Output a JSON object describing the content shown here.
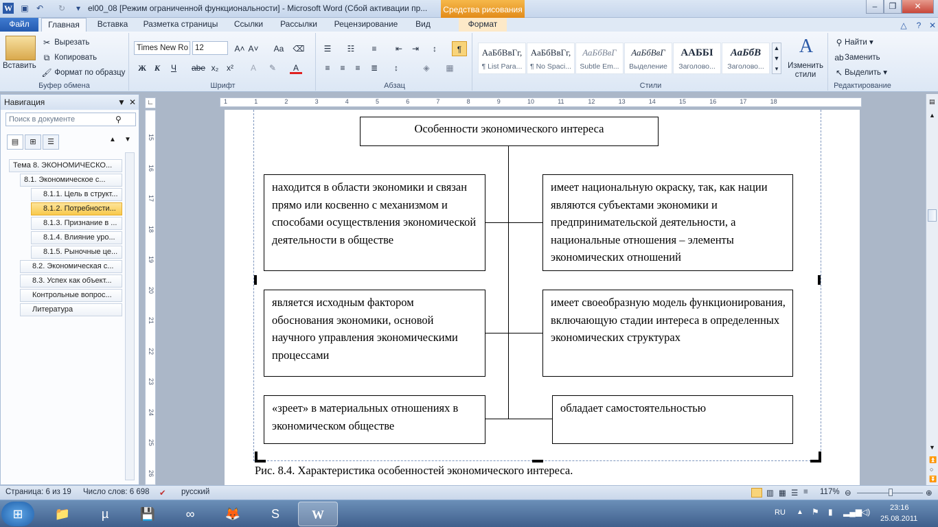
{
  "window": {
    "title": "el00_08 [Режим ограниченной функциональности]  -  Microsoft Word (Сбой активации пр...",
    "context_tab": "Средства рисования",
    "app_icon": "W"
  },
  "tabs": [
    {
      "label": "Файл"
    },
    {
      "label": "Главная"
    },
    {
      "label": "Вставка"
    },
    {
      "label": "Разметка страницы"
    },
    {
      "label": "Ссылки"
    },
    {
      "label": "Рассылки"
    },
    {
      "label": "Рецензирование"
    },
    {
      "label": "Вид"
    },
    {
      "label": "Формат"
    }
  ],
  "ribbon": {
    "clipboard": {
      "paste": "Вставить",
      "cut": "Вырезать",
      "copy": "Копировать",
      "format_painter": "Формат по образцу",
      "label": "Буфер обмена"
    },
    "font": {
      "name": "Times New Ro",
      "size": "12",
      "label": "Шрифт",
      "bold": "Ж",
      "italic": "К",
      "underline": "Ч",
      "strike": "abe",
      "sub": "x₂",
      "sup": "x²",
      "aa": "Aa"
    },
    "paragraph": {
      "label": "Абзац",
      "pilcrow": "¶"
    },
    "styles": {
      "label": "Стили",
      "items": [
        {
          "sample": "АаБбВвГг,",
          "name": "¶ List Para..."
        },
        {
          "sample": "АаБбВвГг,",
          "name": "¶ No Spaci..."
        },
        {
          "sample": "АаБбВвГ",
          "name": "Subtle Em..."
        },
        {
          "sample": "АаБбВвГ",
          "name": "Выделение"
        },
        {
          "sample": "ААББІ",
          "name": "Заголово..."
        },
        {
          "sample": "АаБбВ",
          "name": "Заголово..."
        }
      ],
      "change": "Изменить стили"
    },
    "editing": {
      "label": "Редактирование",
      "find": "Найти",
      "replace": "Заменить",
      "select": "Выделить"
    }
  },
  "navigation": {
    "title": "Навигация",
    "search_placeholder": "Поиск в документе",
    "items": [
      {
        "label": "Тема 8. ЭКОНОМИЧЕСКО..."
      },
      {
        "label": "8.1. Экономическое с..."
      },
      {
        "label": "8.1.1. Цель в структ..."
      },
      {
        "label": "8.1.2. Потребности..."
      },
      {
        "label": "8.1.3. Признание в ..."
      },
      {
        "label": "8.1.4. Влияние уро..."
      },
      {
        "label": "8.1.5. Рыночные це..."
      },
      {
        "label": "8.2. Экономическая с..."
      },
      {
        "label": "8.3. Успех как объект..."
      },
      {
        "label": "Контрольные вопрос..."
      },
      {
        "label": "Литература"
      }
    ]
  },
  "document": {
    "top_box": "Особенности экономического  интереса",
    "left_boxes": [
      "находится в области экономики и связан прямо или косвенно с механизмом и способами осуществления экономической деятельности в обществе",
      "является исходным фактором обоснования экономики, основой научного управления экономическими процессами",
      "«зреет» в материальных отношениях в экономическом обществе"
    ],
    "right_boxes": [
      "имеет национальную окраску, так, как нации являются субъектами экономики и предпринимательской деятельности, а национальные отношения – элементы экономических отношений",
      "имеет своеобразную модель функционирования, включающую стадии интереса в  определенных экономических структурах",
      "обладает самостоятельностью"
    ],
    "caption": "Рис. 8.4. Характеристика особенностей экономического интереса."
  },
  "status": {
    "page": "Страница: 6 из 19",
    "words": "Число слов: 6 698",
    "language": "русский",
    "zoom": "117%"
  },
  "taskbar": {
    "language": "RU",
    "time": "23:16",
    "date": "25.08.2011"
  },
  "ruler": {
    "h_ticks": [
      "1",
      "1",
      "2",
      "3",
      "4",
      "5",
      "6",
      "7",
      "8",
      "9",
      "10",
      "11",
      "12",
      "13",
      "14",
      "15",
      "16",
      "17",
      "18"
    ],
    "v_ticks": [
      "15",
      "16",
      "17",
      "18",
      "19",
      "20",
      "21",
      "22",
      "23",
      "24",
      "25",
      "26"
    ]
  }
}
